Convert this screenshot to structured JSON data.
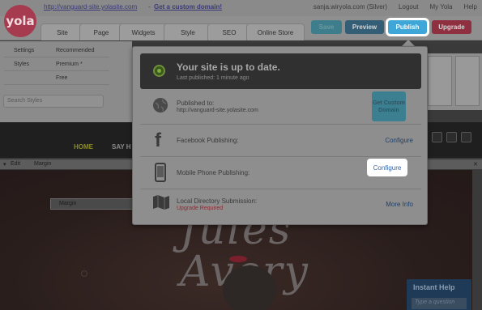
{
  "topbar": {
    "logo": "yola",
    "site_url": "http://vanguard-site.yolasite.com",
    "custom_domain": "Get a custom domain!",
    "user": "sanja.wiryola.com (Silver)",
    "links": [
      "Logout",
      "My Yola",
      "Help"
    ]
  },
  "tabs": [
    "Site",
    "Page",
    "Widgets",
    "Style",
    "SEO",
    "Online Store"
  ],
  "buttons": {
    "save": "Save",
    "preview": "Preview",
    "publish": "Publish",
    "upgrade": "Upgrade"
  },
  "leftpanel": {
    "rows": [
      [
        "Settings",
        "Recommended"
      ],
      [
        "Styles",
        "Premium *"
      ],
      [
        "",
        "Free"
      ]
    ],
    "search_placeholder": "Search Styles"
  },
  "site_nav": {
    "home": "HOME",
    "say": "SAY H"
  },
  "editbar": {
    "edit": "Edit",
    "margin": "Margin"
  },
  "hero": {
    "margin_label": "Margin",
    "title": "Jules\nAvery"
  },
  "instant_help": {
    "title": "Instant Help",
    "placeholder": "Type a question"
  },
  "publish_popup": {
    "status_title": "Your site is up to date.",
    "status_sub": "Last published: 1 minute ago",
    "rows": [
      {
        "label": "Published to:",
        "url": "http://vanguard-site.yolasite.com",
        "action": "Get Custom Domain",
        "icon": "globe-icon"
      },
      {
        "label": "Facebook Publishing:",
        "action": "Configure",
        "icon": "facebook-icon"
      },
      {
        "label": "Mobile Phone Publishing:",
        "action": "Configure",
        "icon": "mobile-phone-icon"
      },
      {
        "label": "Local Directory Submission:",
        "note": "Upgrade Required",
        "action": "More Info",
        "icon": "map-icon"
      }
    ]
  }
}
